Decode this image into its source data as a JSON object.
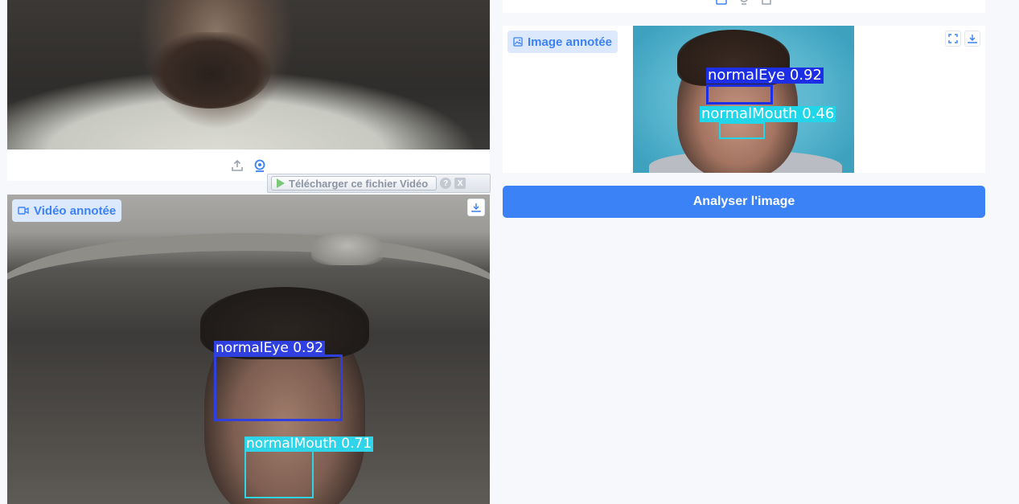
{
  "webcam": {
    "upload_icon": "upload-icon",
    "webcam_icon": "webcam-icon"
  },
  "download_bar": {
    "label": "Télécharger ce fichier Vidéo",
    "help": "?",
    "close": "X"
  },
  "annotated_video": {
    "label": "Vidéo annotée",
    "detections": [
      {
        "label": "normalEye 0.92",
        "class": "normalEye",
        "confidence": 0.92,
        "color": "#2f3fe0"
      },
      {
        "label": "normalMouth 0.71",
        "class": "normalMouth",
        "confidence": 0.71,
        "color": "#2fd4e8"
      }
    ]
  },
  "annotated_image": {
    "label": "Image annotée",
    "detections": [
      {
        "label": "normalEye 0.92",
        "class": "normalEye",
        "confidence": 0.92,
        "color": "#1c2fe6"
      },
      {
        "label": "normalMouth 0.46",
        "class": "normalMouth",
        "confidence": 0.46,
        "color": "#22d6ea"
      }
    ]
  },
  "actions": {
    "analyze_label": "Analyser l'image"
  },
  "colors": {
    "accent": "#3b82f6",
    "tag_bg": "#dce8fc",
    "page_bg": "#f6f8fb"
  }
}
